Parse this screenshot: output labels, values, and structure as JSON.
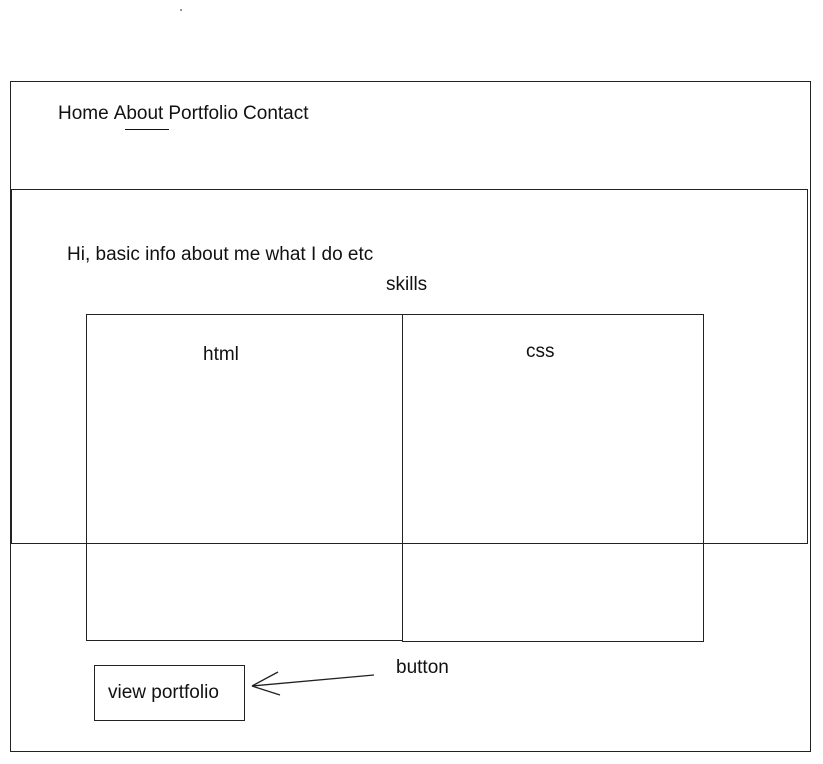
{
  "nav": {
    "items": [
      {
        "label": "Home",
        "active": false
      },
      {
        "label": "About",
        "active": true
      },
      {
        "label": "Portfolio",
        "active": false
      },
      {
        "label": "Contact",
        "active": false
      }
    ]
  },
  "hero": {
    "intro": "Hi, basic info about me what I do etc"
  },
  "skills": {
    "heading": "skills",
    "items": [
      {
        "label": "html"
      },
      {
        "label": "css"
      }
    ]
  },
  "cta": {
    "button_label": "view portfolio",
    "annotation": "button"
  },
  "colors": {
    "line": "#222222",
    "text": "#111111",
    "background": "#ffffff"
  }
}
